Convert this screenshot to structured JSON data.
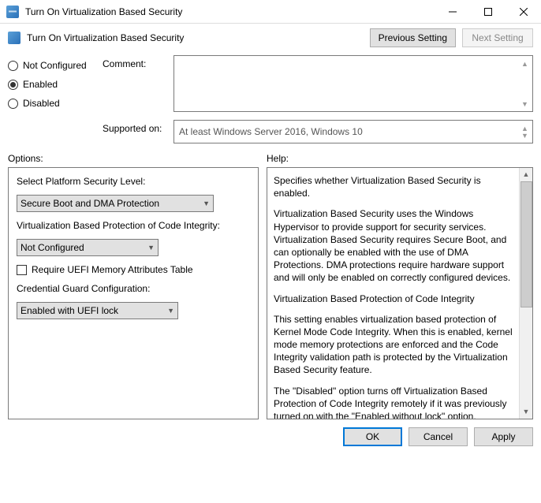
{
  "window": {
    "title": "Turn On Virtualization Based Security"
  },
  "header": {
    "title": "Turn On Virtualization Based Security",
    "prev": "Previous Setting",
    "next": "Next Setting"
  },
  "state": {
    "not_configured": "Not Configured",
    "enabled": "Enabled",
    "disabled": "Disabled",
    "selected": "enabled"
  },
  "fields": {
    "comment_label": "Comment:",
    "comment_value": "",
    "supported_label": "Supported on:",
    "supported_value": "At least Windows Server 2016, Windows 10"
  },
  "labels": {
    "options": "Options:",
    "help": "Help:"
  },
  "options": {
    "platform_label": "Select Platform Security Level:",
    "platform_value": "Secure Boot and DMA Protection",
    "vbs_label": "Virtualization Based Protection of Code Integrity:",
    "vbs_value": "Not Configured",
    "uefi_checkbox": "Require UEFI Memory Attributes Table",
    "cred_label": "Credential Guard Configuration:",
    "cred_value": "Enabled with UEFI lock"
  },
  "help": {
    "p1": "Specifies whether Virtualization Based Security is enabled.",
    "p2": "Virtualization Based Security uses the Windows Hypervisor to provide support for security services. Virtualization Based Security requires Secure Boot, and can optionally be enabled with the use of DMA Protections. DMA protections require hardware support and will only be enabled on correctly configured devices.",
    "p3": "Virtualization Based Protection of Code Integrity",
    "p4": "This setting enables virtualization based protection of Kernel Mode Code Integrity. When this is enabled, kernel mode memory protections are enforced and the Code Integrity validation path is protected by the Virtualization Based Security feature.",
    "p5": "The \"Disabled\" option turns off Virtualization Based Protection of Code Integrity remotely if it was previously turned on with the \"Enabled without lock\" option."
  },
  "footer": {
    "ok": "OK",
    "cancel": "Cancel",
    "apply": "Apply"
  }
}
